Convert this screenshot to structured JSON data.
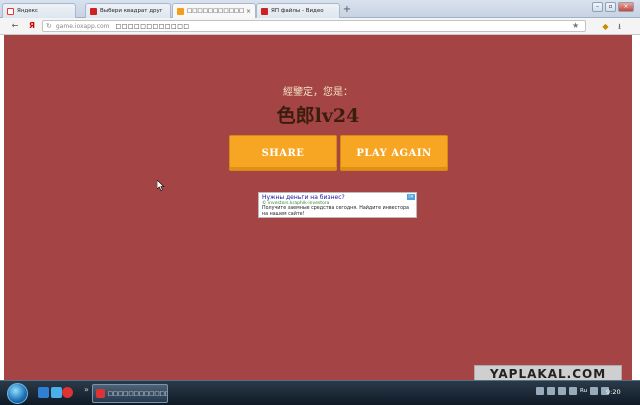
{
  "browser": {
    "tabs": [
      {
        "label": "Яндекс",
        "favicon": "yandex-icon",
        "active": false
      },
      {
        "label": "Выбери квадрат друг",
        "favicon": "yaplakal-icon",
        "active": false
      },
      {
        "label": "□□□□□□□□□□□□",
        "favicon": "ioxapp-icon",
        "active": true
      },
      {
        "label": "ЯП файлы - Видео",
        "favicon": "yaplakal-icon",
        "active": false
      }
    ],
    "new_tab": "+",
    "address_url": "game.ioxapp.com",
    "page_title": "□□□□□□□□□□□□",
    "back_symbol": "←",
    "yandex_symbol": "Я"
  },
  "game": {
    "result_label": "經鑒定，您是：",
    "result_title": "色郎lv24",
    "share_button": "SHARE",
    "play_again_button": "PLAY AGAIN"
  },
  "ad": {
    "title": "Нужны деньги на бизнес?",
    "url": "© investors.kraphik-investora",
    "text": "Получите заемные средства сегодня. Найдите инвестора на нашем сайте!"
  },
  "watermark": "YAPLAKAL.COM",
  "taskbar": {
    "active_window": "□□□□□□□□□□□□",
    "language": "Ru",
    "clock": "9:20"
  },
  "colors": {
    "page_background": "#a54444",
    "button": "#f6a623",
    "title_text": "#3b1d10"
  }
}
